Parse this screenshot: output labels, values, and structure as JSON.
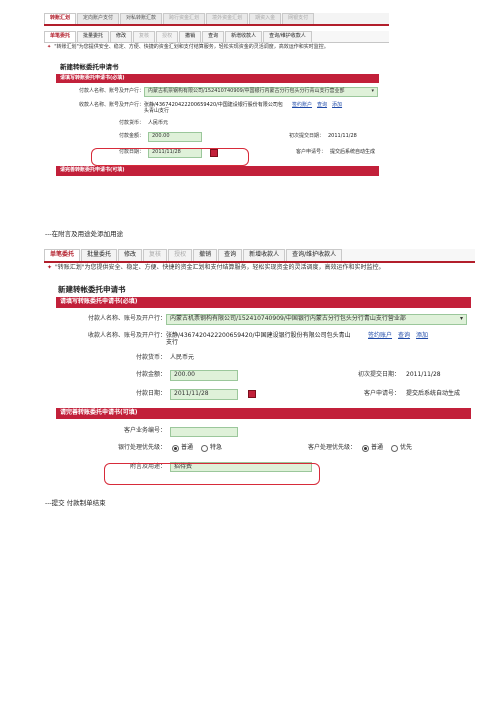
{
  "shot1": {
    "top_tabs": [
      "转账汇划",
      "定向账户支付",
      "对私转账汇款",
      "跨行资金汇划",
      "境外资金汇划",
      "期资入金",
      "网银支付"
    ],
    "sub_tabs": [
      "单笔委托",
      "批量委托",
      "修改",
      "复核",
      "授权",
      "撤销",
      "查询",
      "新增收款人",
      "查询/维护收款人"
    ],
    "notice": "\"转账汇划\"为您提供安全、稳定、方便、快捷的资金汇划和支付结算服务，轻松实现资金的灵活调度，高效运作和实时监控。",
    "form_title": "新建转帐委托申请书",
    "section_required": "请填写转账委托申请书(必填)",
    "payer_label": "付款人名称、账号及开户行：",
    "payer_value": "内蒙古机票钢构有限公司/152410740909/中国银行内蒙古分行包头分行青山支行营业部",
    "payee_label": "收款人名称、账号及开户行：",
    "payee_value": "张静/4367420422200659420/中国建设银行股份有限公司包头青山支行",
    "link_payee": "签约账户",
    "link_query": "查询",
    "link_add": "添加",
    "currency_label": "付款货币：",
    "currency_value": "人民币元",
    "amount_label": "付款金额：",
    "amount_value": "200.00",
    "submit_date_label": "初次提交日期：",
    "submit_date_value": "2011/11/28",
    "pay_date_label": "付款日期：",
    "pay_date_value": "2011/11/28",
    "client_app_label": "客户申请号：",
    "client_app_value": "提交后系统自动生成",
    "section_optional": "请完善转账委托申请书(可填)"
  },
  "caption1": "---在附言及用途处添加用途",
  "shot2": {
    "sub_tabs": [
      "单笔委托",
      "批量委托",
      "修改",
      "复核",
      "授权",
      "撤销",
      "查询",
      "新增收款人",
      "查询/维护收款人"
    ],
    "notice": "\"转账汇划\"为您提供安全、稳定、方便、快捷的资金汇划和支付结算服务，轻松实现资金的灵活调度，高效运作和实时监控。",
    "form_title": "新建转帐委托申请书",
    "section_required": "请填写转账委托申请书(必填)",
    "payer_label": "付款人名称、账号及开户行：",
    "payer_value": "内蒙古机票钢构有限公司/152410740909/中国银行内蒙古分行包头分行青山支行营业部",
    "payee_label": "收款人名称、账号及开户行：",
    "payee_value": "张静/4367420422200659420/中国建设银行股份有限公司包头青山支行",
    "link_payee": "签约账户",
    "link_query": "查询",
    "link_add": "添加",
    "currency_label": "付款货币：",
    "currency_value": "人民币元",
    "amount_label": "付款金额：",
    "amount_value": "200.00",
    "submit_date_label": "初次提交日期：",
    "submit_date_value": "2011/11/28",
    "pay_date_label": "付款日期：",
    "pay_date_value": "2011/11/28",
    "client_app_label": "客户申请号：",
    "client_app_value": "提交后系统自动生成",
    "section_optional": "请完善转账委托申请书(可填)",
    "biz_no_label": "客户业务编号：",
    "bank_priority_label": "银行处理优先级：",
    "client_priority_label": "客户处理优先级：",
    "opt_normal": "普通",
    "opt_urgent": "特急",
    "opt_priority": "优先",
    "remark_label": "附言及用途：",
    "remark_value": "招待费"
  },
  "caption2": "---提交   付款制单结束"
}
